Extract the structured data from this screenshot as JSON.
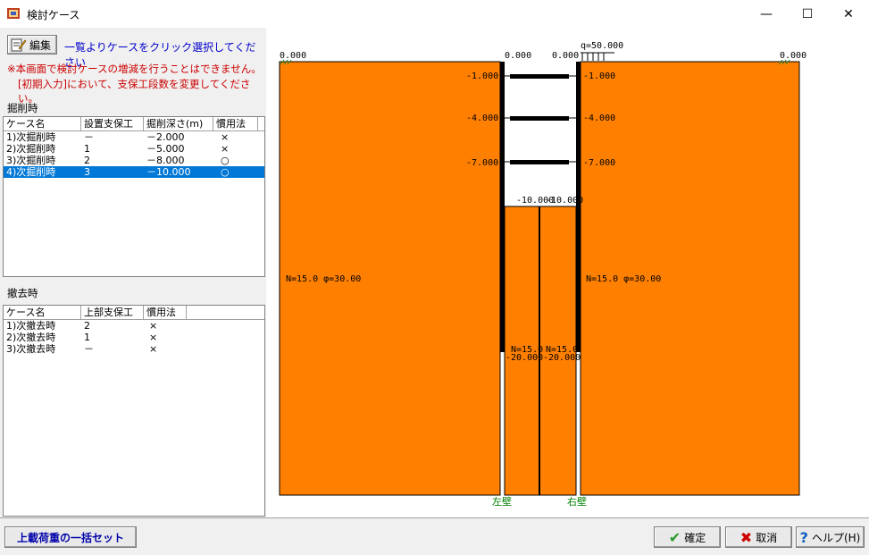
{
  "window": {
    "title": "検討ケース",
    "minimize": "—",
    "maximize": "☐",
    "close": "✕"
  },
  "left": {
    "edit_label": "編集",
    "hint": "一覧よりケースをクリック選択してください",
    "warning1": "※本画面で検討ケースの増減を行うことはできません。",
    "warning2": "[初期入力]において、支保工段数を変更してください。",
    "excavation": {
      "label": "掘削時",
      "headers": [
        "ケース名",
        "設置支保工",
        "掘削深さ(m)",
        "慣用法"
      ],
      "rows": [
        [
          "1)次掘削時",
          "－",
          "－2.000",
          "×"
        ],
        [
          "2)次掘削時",
          "1",
          "－5.000",
          "×"
        ],
        [
          "3)次掘削時",
          "2",
          "－8.000",
          "○"
        ],
        [
          "4)次掘削時",
          "3",
          "－10.000",
          "○"
        ]
      ]
    },
    "removal": {
      "label": "撤去時",
      "headers": [
        "ケース名",
        "上部支保工",
        "慣用法"
      ],
      "rows": [
        [
          "1)次撤去時",
          "2",
          "×"
        ],
        [
          "2)次撤去時",
          "1",
          "×"
        ],
        [
          "3)次撤去時",
          "－",
          "×"
        ]
      ]
    }
  },
  "diagram": {
    "ground_left": "0.000",
    "ground_inner_left": "0.000",
    "ground_inner_right": "0.000",
    "ground_right": "0.000",
    "load": "q=50.000",
    "struts": [
      "-1.000",
      "-4.000",
      "-7.000"
    ],
    "excavation_left": "-10.000",
    "excavation_right": "-10.000",
    "soil_left": "N=15.0 φ=30.00",
    "soil_right": "N=15.0 φ=30.00",
    "soil_inner_left": "N=15.0",
    "soil_inner_right": "N=15.0",
    "toe_left": "-20.000",
    "toe_right": "-20.000",
    "wall_left": "左壁",
    "wall_right": "右壁",
    "soil_color": "#ff8000"
  },
  "buttons": {
    "bulk_load": "上載荷重の一括セット",
    "ok": "確定",
    "cancel": "取消",
    "help": "ヘルプ(H)"
  }
}
